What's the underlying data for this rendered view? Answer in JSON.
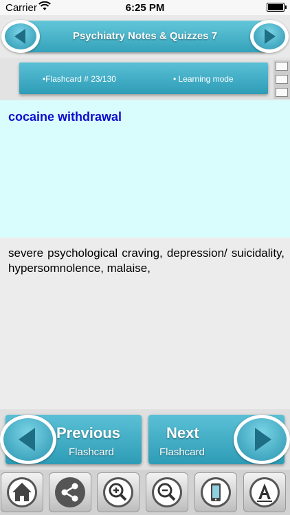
{
  "status_bar": {
    "carrier": "Carrier",
    "time": "6:25 PM"
  },
  "header": {
    "title": "Psychiatry Notes & Quizzes 7"
  },
  "info": {
    "flashcard": "•Flashcard #  23/130",
    "mode": "• Learning mode"
  },
  "card": {
    "question": "cocaine withdrawal",
    "answer": "severe psychological craving, depression/ suicidality, hypersomnolence, malaise,"
  },
  "nav": {
    "previous_line1": "Previous",
    "previous_line2": "Flashcard",
    "next_line1": "Next",
    "next_line2": "Flashcard"
  },
  "toolbar_icons": [
    "home-icon",
    "share-icon",
    "zoom-in-icon",
    "zoom-out-icon",
    "mobile-icon",
    "font-icon"
  ],
  "colors": {
    "accent": "#34a3bb",
    "question_bg": "#d9fcfd",
    "question_text": "#0d0dcc"
  }
}
